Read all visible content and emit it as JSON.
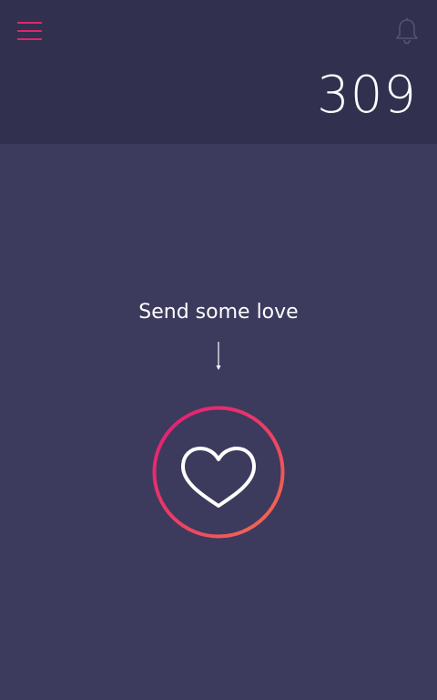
{
  "header": {
    "menu_icon": "hamburger-menu-icon",
    "notification_icon": "bell-icon",
    "count": "309"
  },
  "main": {
    "prompt": "Send some love",
    "arrow_icon": "arrow-down-icon",
    "heart_icon": "heart-icon"
  },
  "colors": {
    "header_bg": "#31304e",
    "body_bg": "#3c3a5d",
    "accent_pink": "#e21a77",
    "accent_orange": "#f5714a",
    "menu_pink": "#e0256e"
  }
}
